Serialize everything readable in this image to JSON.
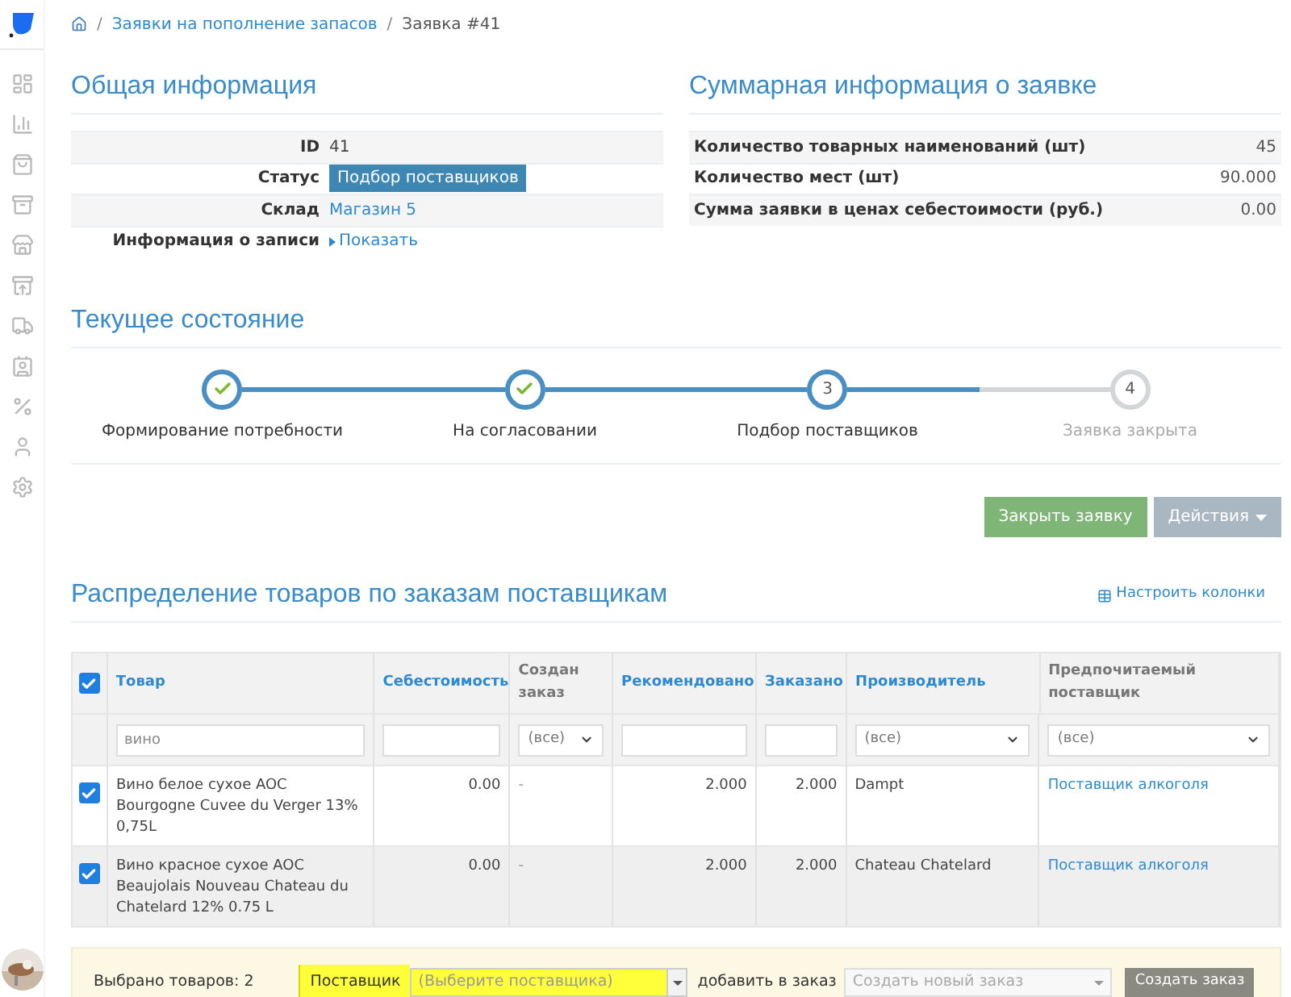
{
  "breadcrumb": [
    {
      "separator": "/",
      "label": "Заявки на пополнение запасов",
      "kind": "link"
    },
    {
      "separator": "/",
      "label": "Заявка #41",
      "kind": "current"
    }
  ],
  "general": {
    "title": "Общая информация",
    "rows": [
      {
        "label": "ID",
        "value": "41",
        "kind": "text"
      },
      {
        "label": "Статус",
        "value": "Подбор поставщиков",
        "kind": "badge"
      },
      {
        "label": "Склад",
        "value": "Магазин 5",
        "kind": "link"
      },
      {
        "label": "Информация о записи",
        "value": "Показать",
        "kind": "toggle"
      }
    ]
  },
  "summary": {
    "title": "Суммарная информация о заявке",
    "rows": [
      {
        "label": "Количество товарных наименований (шт)",
        "value": "45"
      },
      {
        "label": "Количество мест (шт)",
        "value": "90.000"
      },
      {
        "label": "Сумма заявки в ценах себестоимости (руб.)",
        "value": "0.00"
      }
    ]
  },
  "progress": {
    "title": "Текущее состояние",
    "steps": [
      {
        "label": "Формирование потребности",
        "kind": "done"
      },
      {
        "label": "На согласовании",
        "kind": "done"
      },
      {
        "label": "Подбор поставщиков",
        "number": "3",
        "kind": "current"
      },
      {
        "label": "Заявка закрыта",
        "number": "4",
        "kind": "pending"
      }
    ]
  },
  "actions": [
    {
      "label": "Закрыть заявку",
      "kind": "primary"
    },
    {
      "label": "Действия",
      "kind": "dropdown"
    }
  ],
  "distribution": {
    "title": "Распределение товаров по заказам поставщикам",
    "configure": "Настроить колонки",
    "all_checked": true,
    "columns": [
      {
        "label": "Товар",
        "sortable": true,
        "filter": {
          "kind": "input",
          "value": "вино"
        }
      },
      {
        "label": "Себестоимость",
        "sortable": true,
        "filter": {
          "kind": "input"
        }
      },
      {
        "label": "Создан заказ",
        "sortable": false,
        "filter": {
          "kind": "select",
          "value": "(все)"
        }
      },
      {
        "label": "Рекомендовано",
        "sortable": true,
        "filter": {
          "kind": "input"
        }
      },
      {
        "label": "Заказано",
        "sortable": true,
        "filter": {
          "kind": "input"
        }
      },
      {
        "label": "Производитель",
        "sortable": true,
        "filter": {
          "kind": "select",
          "value": "(все)"
        }
      },
      {
        "label": "Предпочитаемый поставщик",
        "sortable": false,
        "filter": {
          "kind": "select",
          "value": "(все)"
        }
      }
    ],
    "rows": [
      {
        "checked": true,
        "cells": [
          "Вино белое сухое AOC Bourgogne Cuvee du Verger 13% 0,75L",
          "0.00",
          "-",
          "2.000",
          "2.000",
          "Dampt",
          "Поставщик алкоголя"
        ]
      },
      {
        "checked": true,
        "cells": [
          "Вино красное сухое AOC Beaujolais Nouveau Chateau du Chatelard 12% 0.75 L",
          "0.00",
          "-",
          "2.000",
          "2.000",
          "Chateau Chatelard",
          "Поставщик алкоголя"
        ]
      }
    ]
  },
  "footer": {
    "selected": "Выбрано товаров: 2",
    "supplier_label": "Поставщик",
    "supplier_placeholder": "(Выберите поставщика)",
    "add_label": "добавить в заказ",
    "order_placeholder": "Создать новый заказ",
    "create": "Создать заказ"
  }
}
